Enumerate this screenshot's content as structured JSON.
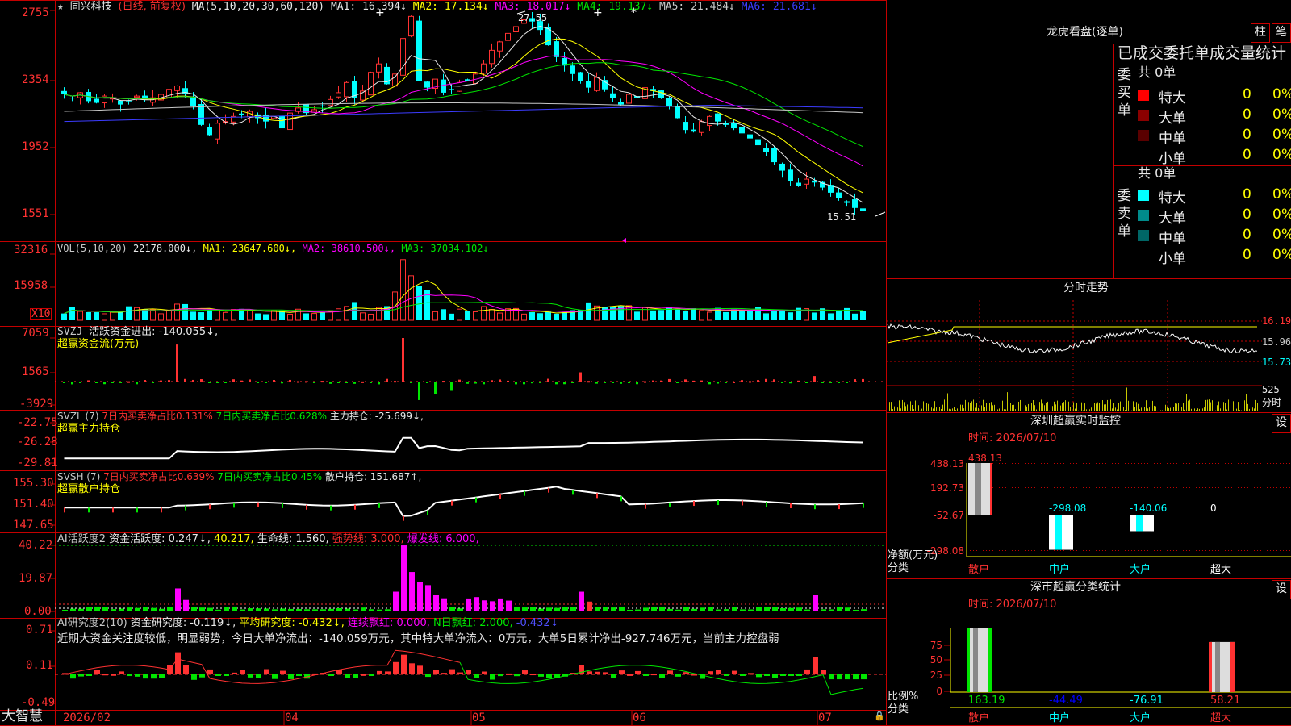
{
  "main_chart": {
    "stock_name": "同兴科技",
    "period_label": "(日线, 前复权)",
    "ma_params": "MA(5,10,20,30,60,120)",
    "ma_values": [
      {
        "label": "MA1: 16.394↓",
        "color": "#e8e8e8"
      },
      {
        "label": "MA2: 17.134↓",
        "color": "#ffff00"
      },
      {
        "label": "MA3: 18.017↓",
        "color": "#ff00ff"
      },
      {
        "label": "MA4: 19.137↓",
        "color": "#00e600"
      },
      {
        "label": "MA5: 21.484↓",
        "color": "#c8c8c8"
      },
      {
        "label": "MA6: 21.681↓",
        "color": "#3c3cff"
      }
    ],
    "y_ticks": [
      "2755",
      "2354",
      "1952",
      "1551"
    ],
    "high_label": "27.55",
    "low_label": "15.51"
  },
  "vol_panel": {
    "title": "VOL(5,10,20)",
    "vol_value": "22178.000↓,",
    "ma1": "MA1: 23647.600↓,",
    "ma2": "MA2: 38610.500↓,",
    "ma3": "MA3: 37034.102↓",
    "y_ticks": [
      "32316",
      "15958"
    ],
    "unit_badge": "X10"
  },
  "svzj_panel": {
    "title": "SVZJ",
    "label": "活跃资金进出: -140.055↓,",
    "subtitle": "超赢资金流(万元)",
    "y_ticks": [
      "7059",
      "1565",
      "-3929"
    ]
  },
  "svzl_panel": {
    "title": "SVZL (7)",
    "t1": "7日内买卖净占比0.131%",
    "t2": "7日内买卖净占比0.628%",
    "t3": "主力持仓: -25.699↓,",
    "subtitle": "超赢主力持仓",
    "y_ticks": [
      "-22.75",
      "-26.28",
      "-29.81"
    ]
  },
  "svsh_panel": {
    "title": "SVSH (7)",
    "t1": "7日内买卖净占比0.639%",
    "t2": "7日内买卖净占比0.45%",
    "t3": "散户持仓: 151.687↑,",
    "subtitle": "超赢散户持仓",
    "y_ticks": [
      "155.30",
      "151.40",
      "147.65"
    ]
  },
  "ai_active_panel": {
    "title": "AI活跃度2",
    "t1": "资金活跃度: 0.247↓,",
    "t2": "40.217,",
    "t3": "生命线: 1.560,",
    "t4": "强势线: 3.000,",
    "t5": "爆发线: 6.000,",
    "y_ticks": [
      "40.22",
      "19.87",
      "0.00"
    ]
  },
  "ai_research_panel": {
    "title": "AI研究度2(10)",
    "t1": "资金研究度: -0.119↓,",
    "t2": "平均研究度: -0.432↓,",
    "t3": "连续飘红: 0.000,",
    "t4": "N日飘红: 2.000,",
    "t5": "-0.432↓",
    "comment": "近期大资金关注度较低，明显弱势，今日大单净流出：-140.059万元，其中特大单净流入：0万元，大单5日累计净出-927.746万元，当前主力控盘弱",
    "y_ticks": [
      "0.71",
      "0.11",
      "-0.49"
    ]
  },
  "x_axis": {
    "labels": [
      "2026/02",
      "04",
      "05",
      "06",
      "07"
    ],
    "brand": "大智慧"
  },
  "dragon_tiger": {
    "title": "龙虎看盘(逐单)",
    "btn_column": "柱",
    "btn_stroke": "笔",
    "header": "已成交委托单成交量统计",
    "buy_label": "委买单",
    "sell_label": "委卖单",
    "buy_total": "共 0单",
    "sell_total": "共 0单",
    "buy_rows": [
      {
        "name": "特大",
        "count": "0",
        "pct": "0%",
        "color": "#ff0000"
      },
      {
        "name": "大单",
        "count": "0",
        "pct": "0%",
        "color": "#8b0000"
      },
      {
        "name": "中单",
        "count": "0",
        "pct": "0%",
        "color": "#5a0000"
      },
      {
        "name": "小单",
        "count": "0",
        "pct": "0%",
        "color": "#000000"
      }
    ],
    "sell_rows": [
      {
        "name": "特大",
        "count": "0",
        "pct": "0%",
        "color": "#00ffff"
      },
      {
        "name": "大单",
        "count": "0",
        "pct": "0%",
        "color": "#008b8b"
      },
      {
        "name": "中单",
        "count": "0",
        "pct": "0%",
        "color": "#006666"
      },
      {
        "name": "小单",
        "count": "0",
        "pct": "0%",
        "color": "#000000"
      }
    ]
  },
  "intraday": {
    "title": "分时走势",
    "y_labels": [
      "16.19",
      "15.96",
      "15.73"
    ],
    "vol_label": "525",
    "unit": "分时"
  },
  "sz_monitor": {
    "title": "深圳超赢实时监控",
    "btn": "设",
    "time": "时间: 2026/07/10",
    "y_ticks": [
      "438.13",
      "192.73",
      "-52.67",
      "-298.08"
    ],
    "ylabel": "净额(万元)",
    "xlabel": "分类",
    "categories": [
      "散户",
      "中户",
      "大户",
      "超大"
    ],
    "values": [
      "438.13",
      "-298.08",
      "-140.06",
      "0"
    ]
  },
  "sz_class": {
    "title": "深市超赢分类统计",
    "btn": "设",
    "time": "时间: 2026/07/10",
    "y_ticks": [
      "75",
      "50",
      "25",
      "0"
    ],
    "ylabel": "比例%",
    "xlabel": "分类",
    "categories": [
      "散户",
      "中户",
      "大户",
      "超大"
    ],
    "values": [
      "163.19",
      "-44.49",
      "-76.91",
      "58.21"
    ]
  },
  "chart_data": [
    {
      "type": "bar",
      "title": "深圳超赢实时监控",
      "ylabel": "净额(万元)",
      "categories": [
        "散户",
        "中户",
        "大户",
        "超大"
      ],
      "values": [
        438.13,
        -298.08,
        -140.06,
        0
      ],
      "ylim": [
        -298.08,
        438.13
      ]
    },
    {
      "type": "bar",
      "title": "深市超赢分类统计",
      "ylabel": "比例%",
      "categories": [
        "散户",
        "中户",
        "大户",
        "超大"
      ],
      "values": [
        163.19,
        -44.49,
        -76.91,
        58.21
      ],
      "ylim": [
        0,
        75
      ]
    }
  ]
}
